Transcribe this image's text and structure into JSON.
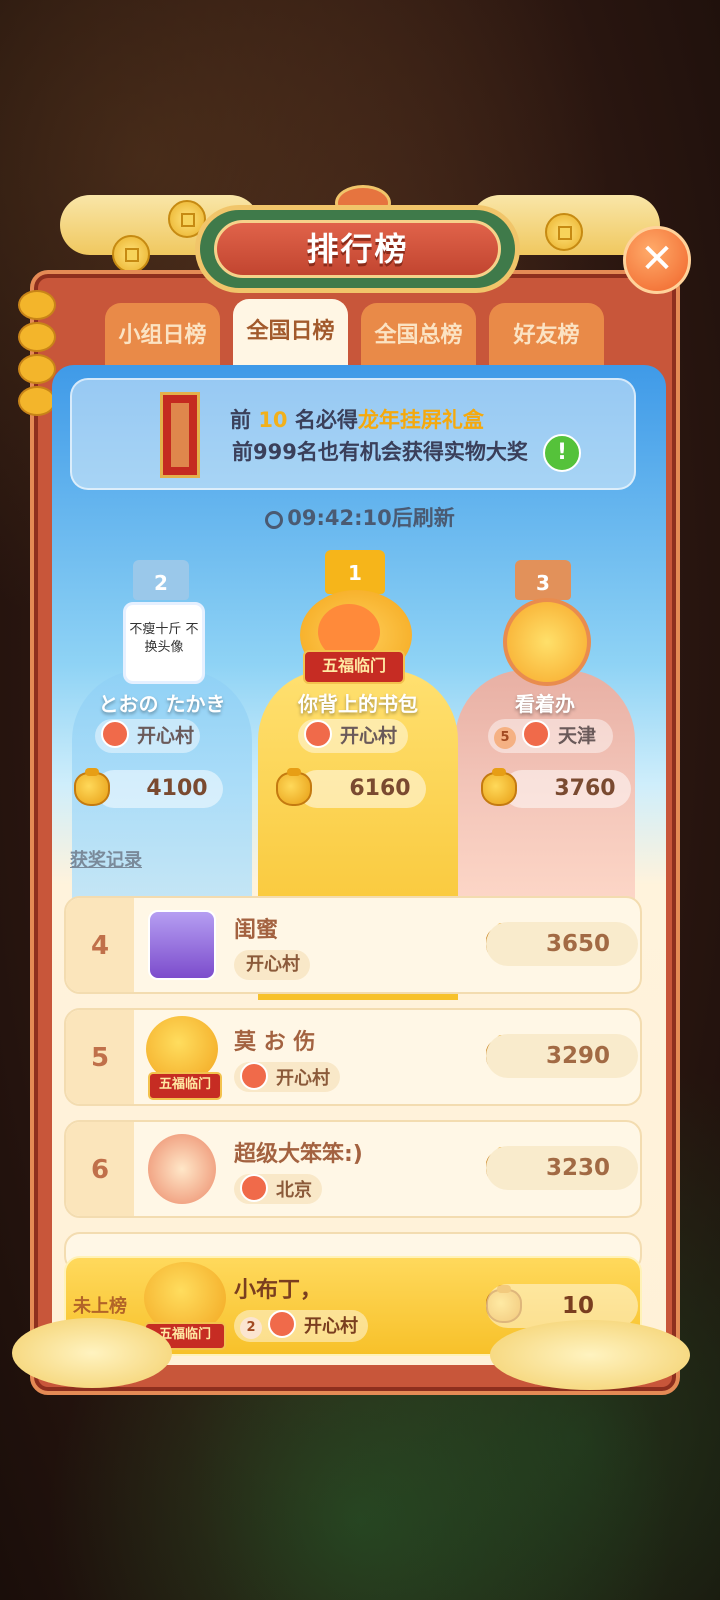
{
  "header": {
    "title": "排行榜"
  },
  "tabs": [
    {
      "label": "小组日榜",
      "active": false
    },
    {
      "label": "全国日榜",
      "active": true
    },
    {
      "label": "全国总榜",
      "active": false
    },
    {
      "label": "好友榜",
      "active": false
    }
  ],
  "banner": {
    "line1_prefix": "前 ",
    "line1_num": "10",
    "line1_mid": " 名必得",
    "line1_prize": "龙年挂屏礼盒",
    "line2": "前999名也有机会获得实物大奖",
    "info_glyph": "!"
  },
  "timer": {
    "text": "09:42:10后刷新"
  },
  "podium": {
    "first": {
      "rank": "1",
      "name": "你背上的书包",
      "region": "开心村",
      "score": "6160",
      "badge": "五福临门"
    },
    "second": {
      "rank": "2",
      "name": "とおの たかき",
      "region": "开心村",
      "score": "4100",
      "avatar_text": "不瘦十斤 不换头像"
    },
    "third": {
      "rank": "3",
      "name": "看着办",
      "level": "5",
      "region": "天津",
      "score": "3760"
    }
  },
  "record_link": "获奖记录",
  "rows": [
    {
      "rank": "4",
      "name": "闺蜜",
      "region": "开心村",
      "score": "3650"
    },
    {
      "rank": "5",
      "name": "莫 お 伤",
      "region": "开心村",
      "score": "3290",
      "badge": "五福临门"
    },
    {
      "rank": "6",
      "name": "超级大笨笨:)",
      "region": "北京",
      "score": "3230"
    }
  ],
  "me": {
    "rank": "未上榜",
    "name": "小布丁，",
    "level": "2",
    "region": "开心村",
    "score": "10",
    "badge": "五福临门"
  },
  "close_icon": "close-icon",
  "colors": {
    "panel": "#c8563a",
    "gold": "#f7c12a",
    "tab_active": "#fff6e4"
  }
}
